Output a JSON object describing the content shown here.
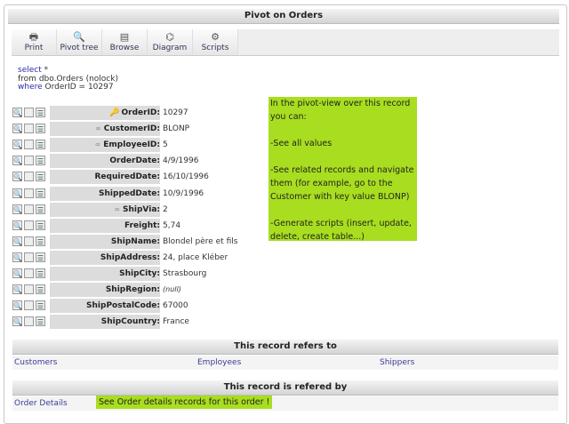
{
  "title": "Pivot on Orders",
  "toolbar": [
    {
      "label": "Print",
      "icon": "printer-icon",
      "glyph": "🖶"
    },
    {
      "label": "Pivot tree",
      "icon": "magnifier-icon",
      "glyph": "🔍"
    },
    {
      "label": "Browse",
      "icon": "document-icon",
      "glyph": "▤"
    },
    {
      "label": "Diagram",
      "icon": "diagram-icon",
      "glyph": "⌬"
    },
    {
      "label": "Scripts",
      "icon": "scripts-icon",
      "glyph": "⚙"
    }
  ],
  "sql": {
    "select_kw": "select",
    "select_rest": " *",
    "from_kw": "from",
    "from_rest": " dbo.Orders (nolock)",
    "where_kw": "where",
    "where_rest": " OrderID = 10297"
  },
  "fields": [
    {
      "name": "OrderID:",
      "value": "10297",
      "badge": "pk"
    },
    {
      "name": "CustomerID:",
      "value": "BLONP",
      "badge": "fk"
    },
    {
      "name": "EmployeeID:",
      "value": "5",
      "badge": "fk"
    },
    {
      "name": "OrderDate:",
      "value": "4/9/1996"
    },
    {
      "name": "RequiredDate:",
      "value": "16/10/1996"
    },
    {
      "name": "ShippedDate:",
      "value": "10/9/1996"
    },
    {
      "name": "ShipVia:",
      "value": "2",
      "badge": "fk"
    },
    {
      "name": "Freight:",
      "value": "5,74"
    },
    {
      "name": "ShipName:",
      "value": "Blondel père et fils"
    },
    {
      "name": "ShipAddress:",
      "value": "24, place Kléber"
    },
    {
      "name": "ShipCity:",
      "value": "Strasbourg"
    },
    {
      "name": "ShipRegion:",
      "value": "(null)",
      "null": true
    },
    {
      "name": "ShipPostalCode:",
      "value": "67000"
    },
    {
      "name": "ShipCountry:",
      "value": "France"
    }
  ],
  "note": {
    "l1": "In the pivot-view over this record you can:",
    "l2": "-See all values",
    "l3": "-See related records and navigate them (for example, go to the Customer with key value BLONP)",
    "l4": "-Generate scripts (insert, update, delete, create table...)"
  },
  "refers": {
    "title": "This record refers to",
    "links": [
      "Customers",
      "Employees",
      "Shippers"
    ]
  },
  "referedby": {
    "title": "This record is refered by",
    "links": [
      "Order Details"
    ],
    "note": "See Order details records for this order !"
  }
}
